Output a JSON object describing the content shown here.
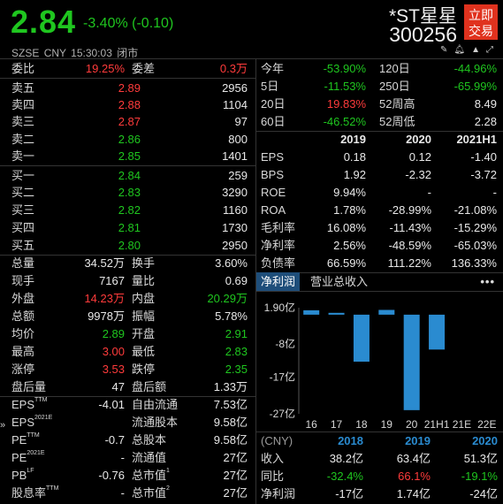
{
  "header": {
    "price": "2.84",
    "change": "-3.40% (-0.10)",
    "exchange": "SZSE",
    "currency": "CNY",
    "time": "15:30:03",
    "status": "闭市",
    "name": "*ST星星",
    "code": "300256",
    "trade_btn_l1": "立即",
    "trade_btn_l2": "交易",
    "accent": "#e0321e",
    "up_color": "#ff3b3b",
    "down_color": "#1fc61f"
  },
  "order_book": {
    "ratio_label": "委比",
    "ratio_value": "19.25%",
    "diff_label": "委差",
    "diff_value": "0.3万",
    "asks": [
      {
        "label": "卖五",
        "price": "2.89",
        "vol": "2956"
      },
      {
        "label": "卖四",
        "price": "2.88",
        "vol": "1104"
      },
      {
        "label": "卖三",
        "price": "2.87",
        "vol": "97"
      },
      {
        "label": "卖二",
        "price": "2.86",
        "vol": "800"
      },
      {
        "label": "卖一",
        "price": "2.85",
        "vol": "1401"
      }
    ],
    "bids": [
      {
        "label": "买一",
        "price": "2.84",
        "vol": "259"
      },
      {
        "label": "买二",
        "price": "2.83",
        "vol": "3290"
      },
      {
        "label": "买三",
        "price": "2.82",
        "vol": "1160"
      },
      {
        "label": "买四",
        "price": "2.81",
        "vol": "1730"
      },
      {
        "label": "买五",
        "price": "2.80",
        "vol": "2950"
      }
    ]
  },
  "stats": [
    {
      "l1": "总量",
      "v1": "34.52万",
      "l2": "换手",
      "v2": "3.60%"
    },
    {
      "l1": "现手",
      "v1": "7167",
      "l2": "量比",
      "v2": "0.69"
    },
    {
      "l1": "外盘",
      "v1": "14.23万",
      "l2": "内盘",
      "v2": "20.29万"
    },
    {
      "l1": "总额",
      "v1": "9978万",
      "l2": "振幅",
      "v2": "5.78%"
    },
    {
      "l1": "均价",
      "v1": "2.89",
      "l2": "开盘",
      "v2": "2.91"
    },
    {
      "l1": "最高",
      "v1": "3.00",
      "l2": "最低",
      "v2": "2.83"
    },
    {
      "l1": "涨停",
      "v1": "3.53",
      "l2": "跌停",
      "v2": "2.35"
    },
    {
      "l1": "盘后量",
      "v1": "47",
      "l2": "盘后额",
      "v2": "1.33万"
    }
  ],
  "fundamentals": [
    {
      "l1": "EPS",
      "l1sup": "TTM",
      "v1": "-4.01",
      "l2": "自由流通",
      "v2": "7.53亿"
    },
    {
      "l1": "EPS",
      "l1sup": "2021E",
      "v1": "",
      "l2": "流通股本",
      "v2": "9.58亿"
    },
    {
      "l1": "PE",
      "l1sup": "TTM",
      "v1": "-0.7",
      "l2": "总股本",
      "v2": "9.58亿"
    },
    {
      "l1": "PE",
      "l1sup": "2021E",
      "v1": "-",
      "l2": "流通值",
      "v2": "27亿"
    },
    {
      "l1": "PB",
      "l1sup": "LF",
      "v1": "-0.76",
      "l2": "总市值",
      "l2sup": "1",
      "v2": "27亿"
    },
    {
      "l1": "股息率",
      "l1sup": "TTM",
      "v1": "-",
      "l2": "总市值",
      "l2sup": "2",
      "v2": "27亿"
    }
  ],
  "performance": [
    {
      "l1": "今年",
      "v1": "-53.90%",
      "l2": "120日",
      "v2": "-44.96%"
    },
    {
      "l1": "5日",
      "v1": "-11.53%",
      "l2": "250日",
      "v2": "-65.99%"
    },
    {
      "l1": "20日",
      "v1": "19.83%",
      "l2": "52周高",
      "v2": "8.49"
    },
    {
      "l1": "60日",
      "v1": "-46.52%",
      "l2": "52周低",
      "v2": "2.28"
    }
  ],
  "ratios": {
    "headers": [
      "2019",
      "2020",
      "2021H1"
    ],
    "rows": [
      {
        "label": "EPS",
        "vals": [
          "0.18",
          "0.12",
          "-1.40"
        ]
      },
      {
        "label": "BPS",
        "vals": [
          "1.92",
          "-2.32",
          "-3.72"
        ]
      },
      {
        "label": "ROE",
        "vals": [
          "9.94%",
          "-",
          "-"
        ]
      },
      {
        "label": "ROA",
        "vals": [
          "1.78%",
          "-28.99%",
          "-21.08%"
        ]
      },
      {
        "label": "毛利率",
        "vals": [
          "16.08%",
          "-11.43%",
          "-15.29%"
        ]
      },
      {
        "label": "净利率",
        "vals": [
          "2.56%",
          "-48.59%",
          "-65.03%"
        ]
      },
      {
        "label": "负债率",
        "vals": [
          "66.59%",
          "111.22%",
          "136.33%"
        ]
      }
    ]
  },
  "tabs": {
    "t1": "净利润",
    "t2": "营业总收入",
    "more": "•••"
  },
  "chart_data": {
    "type": "bar",
    "categories": [
      "16",
      "17",
      "18",
      "19",
      "20",
      "21H1",
      "21E",
      "22E"
    ],
    "values": [
      1.2,
      0.5,
      -12.8,
      1.3,
      -26.0,
      -9.5,
      null,
      null
    ],
    "ytick_labels": [
      "1.90亿",
      "-8亿",
      "-17亿",
      "-27亿"
    ],
    "ytick_values": [
      1.9,
      -8,
      -17,
      -27
    ],
    "ylim": [
      -27,
      1.9
    ],
    "bar_color": "#2a8bd0"
  },
  "annual": {
    "header_label": "(CNY)",
    "years": [
      "2018",
      "2019",
      "2020"
    ],
    "rows": [
      {
        "label": "收入",
        "vals": [
          "38.2亿",
          "63.4亿",
          "51.3亿"
        ]
      },
      {
        "label": "同比",
        "vals": [
          "-32.4%",
          "66.1%",
          "-19.1%"
        ]
      },
      {
        "label": "净利润",
        "vals": [
          "-17亿",
          "1.74亿",
          "-24亿"
        ]
      }
    ]
  },
  "expand_icon": "»"
}
